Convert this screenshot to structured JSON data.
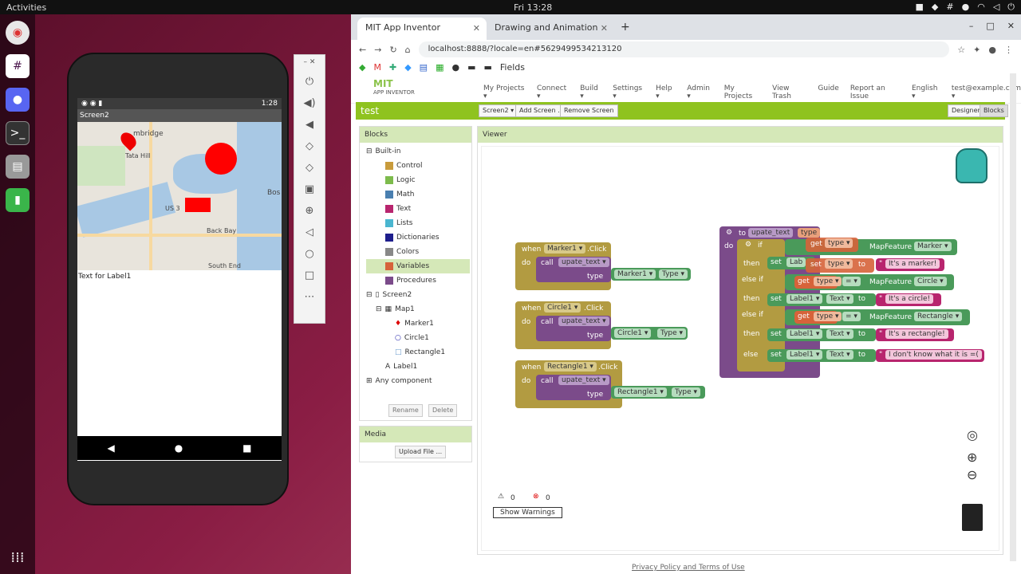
{
  "desktop": {
    "activities": "Activities",
    "clock": "Fri 13:28"
  },
  "phone": {
    "time": "1:28",
    "screen_title": "Screen2",
    "label_text": "Text for Label1",
    "map_labels": {
      "cambridge": "mbridge",
      "back_bay": "Back Bay",
      "south_end": "South End",
      "us3": "US 3",
      "bos": "Bos",
      "tata_hill": "Tata Hill"
    }
  },
  "browser": {
    "tabs": [
      {
        "label": "MIT App Inventor"
      },
      {
        "label": "Drawing and Animation"
      }
    ],
    "url": "localhost:8888/?locale=en#5629499534213120",
    "bookmark_fields": "Fields"
  },
  "ai": {
    "logo_main": "MIT",
    "logo_sub": "APP INVENTOR",
    "menu": [
      "My Projects ▾",
      "Connect ▾",
      "Build ▾",
      "Settings ▾",
      "Help ▾",
      "Admin ▾",
      "My Projects",
      "View Trash",
      "Guide",
      "Report an Issue",
      "English ▾",
      "test@example.com ▾"
    ],
    "project": "test",
    "screen_btn": "Screen2 ▾",
    "add_screen": "Add Screen ...",
    "remove_screen": "Remove Screen",
    "designer": "Designer",
    "blocks": "Blocks",
    "blocks_panel_title": "Blocks",
    "viewer_title": "Viewer",
    "builtin": "Built-in",
    "builtin_items": [
      "Control",
      "Logic",
      "Math",
      "Text",
      "Lists",
      "Dictionaries",
      "Colors",
      "Variables",
      "Procedures"
    ],
    "builtin_colors": [
      "#c89b3c",
      "#7dbb4c",
      "#4a7fb0",
      "#b8256e",
      "#4ab6d0",
      "#1e1e8c",
      "#888888",
      "#d6633a",
      "#7b4b8a"
    ],
    "tree": [
      "Screen2",
      "Map1",
      "Marker1",
      "Circle1",
      "Rectangle1",
      "Label1",
      "Any component"
    ],
    "rename": "Rename",
    "delete": "Delete",
    "media_title": "Media",
    "upload": "Upload File ...",
    "warnings_count": "0",
    "errors_count": "0",
    "show_warnings": "Show Warnings",
    "footer": "Privacy Policy and Terms of Use"
  },
  "blocks": {
    "when": "when",
    "do": "do",
    "call": "call",
    "type": "type",
    "click": ".Click",
    "proc": "upate_text ▾",
    "marker": "Marker1 ▾",
    "circle": "Circle1 ▾",
    "rectangle": "Rectangle1 ▾",
    "type_prop": "Type ▾",
    "to": "to",
    "upate_text": "upate_text",
    "if": "if",
    "then": "then",
    "else_if": "else if",
    "else": "else",
    "get": "get",
    "type_var": "type ▾",
    "eq": "= ▾",
    "mapfeature": "MapFeature",
    "mf_marker": "Marker ▾",
    "mf_circle": "Circle ▾",
    "mf_rect": "Rectangle ▾",
    "set": "set",
    "label1": "Label1 ▾",
    "text": "Text ▾",
    "label_trunc": "Lab",
    "str_marker": "It's a marker!",
    "str_circle": "It's a circle!",
    "str_rect": "It's a rectangle!",
    "str_else": "I don't know what it is =(",
    "quote": "\""
  }
}
